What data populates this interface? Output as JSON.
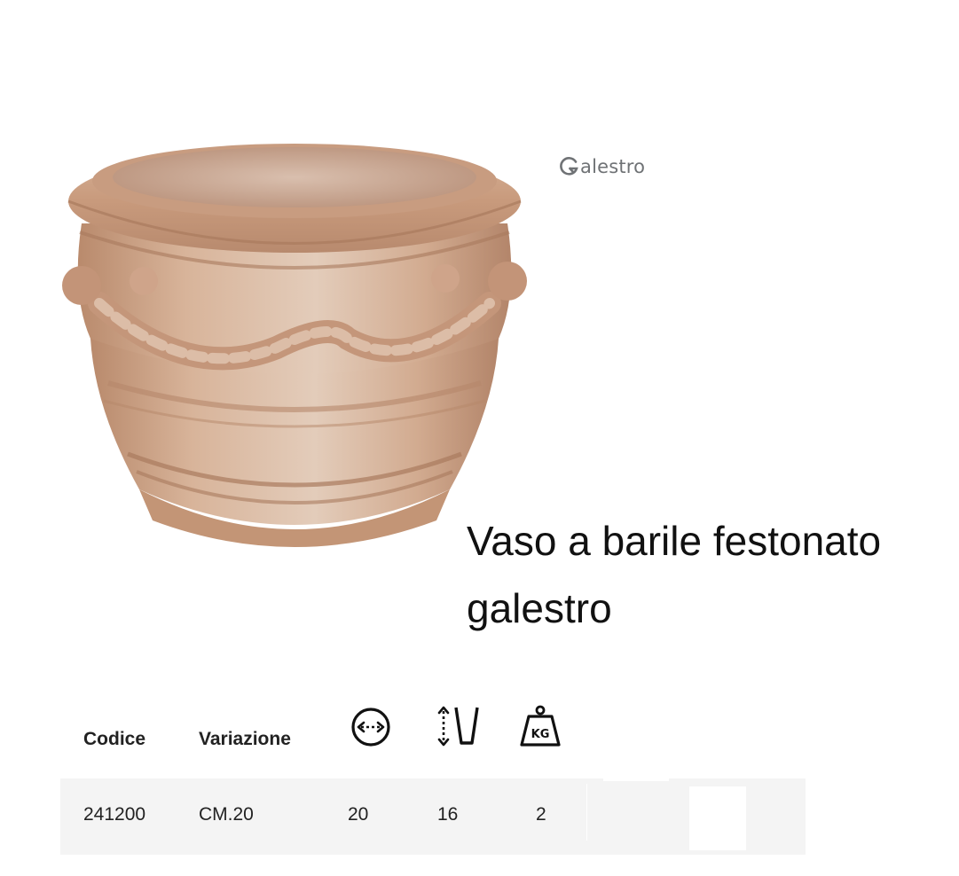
{
  "brand": {
    "name": "alestro",
    "logo_icon": "galestro-g-logo-icon",
    "color": "#6f7275"
  },
  "product": {
    "title_line1": "Vaso a barile festonato",
    "title_line2": "galestro",
    "image_icon": "terracotta-pot-image"
  },
  "table": {
    "headers": {
      "code": "Codice",
      "variation": "Variazione",
      "diameter_icon": "diameter-icon",
      "height_icon": "height-icon",
      "weight_icon": "weight-kg-icon",
      "weight_icon_text": "KG"
    },
    "rows": [
      {
        "code": "241200",
        "variation": "CM.20",
        "diameter": "20",
        "height": "16",
        "weight": "2"
      }
    ]
  },
  "colors": {
    "row_background": "#f4f4f4",
    "text": "#222222",
    "terracotta": "#c9997a"
  }
}
